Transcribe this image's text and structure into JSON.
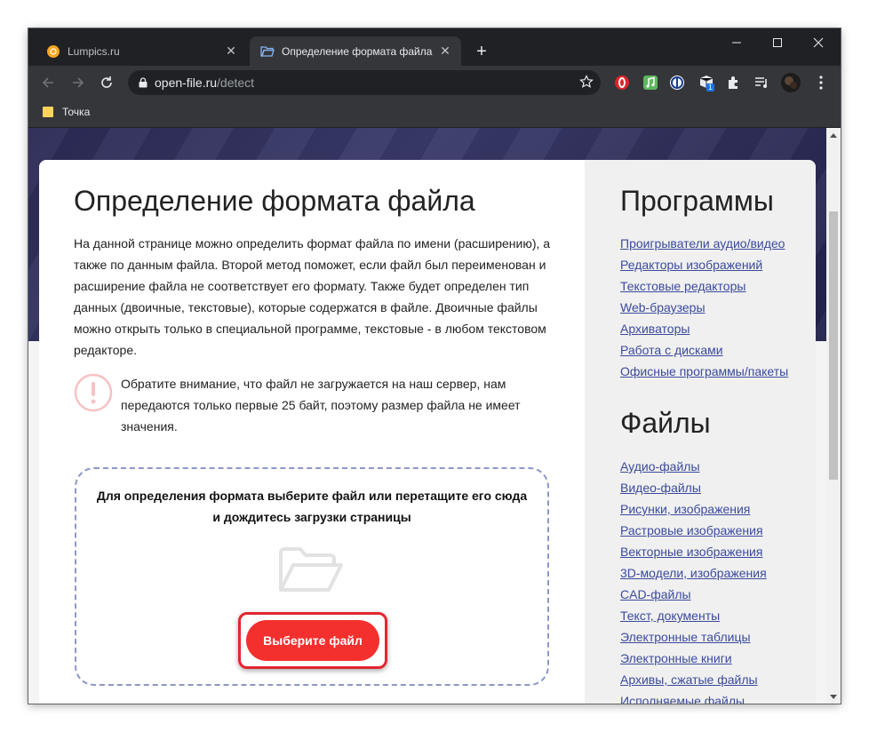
{
  "browser": {
    "tabs": [
      {
        "label": "Lumpics.ru",
        "active": false
      },
      {
        "label": "Определение формата файла",
        "active": true
      }
    ],
    "url_host": "open-file.ru",
    "url_path": "/detect",
    "bookmarks": [
      {
        "label": "Точка"
      }
    ],
    "extension_badge": "1",
    "colors": {
      "tabstrip": "#202124",
      "toolbar": "#35363a"
    }
  },
  "page": {
    "title": "Определение формата файла",
    "intro": "На данной странице можно определить формат файла по имени (расширению), а также по данным файла. Второй метод поможет, если файл был переименован и расширение файла не соответствует его формату. Также будет определен тип данных (двоичные, текстовые), которые содержатся в файле. Двоичные файлы можно открыть только в специальной программе, текстовые - в любом текстовом редакторе.",
    "notice": "Обратите внимание, что файл не загружается на наш сервер, нам передаются только первые 25 байт, поэтому размер файла не имеет значения.",
    "dropzone_text": "Для определения формата выберите файл или перетащите его сюда и дождитесь загрузки страницы",
    "select_button": "Выберите файл",
    "accent": "#f4302f"
  },
  "sidebar": {
    "programs_title": "Программы",
    "programs": [
      "Проигрыватели аудио/видео",
      "Редакторы изображений",
      "Текстовые редакторы",
      "Web-браузеры",
      "Архиваторы",
      "Работа с дисками",
      "Офисные программы/пакеты"
    ],
    "files_title": "Файлы",
    "files": [
      "Аудио-файлы",
      "Видео-файлы",
      "Рисунки, изображения",
      "Растровые изображения",
      "Векторные изображения",
      "3D-модели, изображения",
      "CAD-файлы",
      "Текст, документы",
      "Электронные таблицы",
      "Электронные книги",
      "Архивы, сжатые файлы",
      "Исполняемые файлы"
    ]
  }
}
